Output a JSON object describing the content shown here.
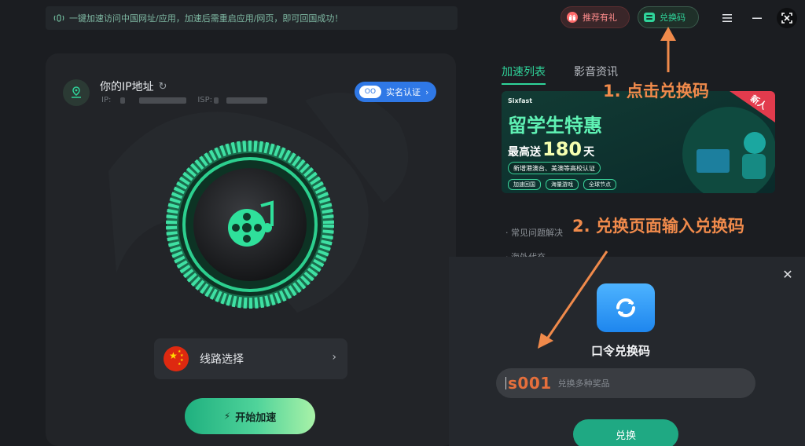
{
  "notice": {
    "text": "一键加速访问中国网址/应用，加速后需重启应用/网页，即可回国成功！"
  },
  "header": {
    "gift_label": "推荐有礼",
    "redeem_label": "兑换码"
  },
  "ip_card": {
    "title": "你的IP地址",
    "ip_prefix": "IP:",
    "isp_prefix": "ISP:",
    "verify_label": "实名认证",
    "verify_tag": "OO"
  },
  "route": {
    "label": "线路选择"
  },
  "start": {
    "label": "开始加速"
  },
  "tabs": [
    {
      "label": "加速列表"
    },
    {
      "label": "影音资讯"
    }
  ],
  "banner": {
    "brand": "Sixfast",
    "headline": "留学生特惠",
    "sub_prefix": "最高送",
    "sub_num": "180",
    "sub_suffix": "天",
    "strip": "新增港澳台、美澳等高校认证",
    "chips": [
      "加速回国",
      "海量游戏",
      "全球节点"
    ],
    "corner": "新人"
  },
  "faq": [
    "常见问题解决",
    "海外代充"
  ],
  "dialog": {
    "title": "口令兑换码",
    "typed_code": "s001",
    "placeholder": "兑换多种奖品",
    "button_label": "兑换"
  },
  "annotations": {
    "step1": "1. 点击兑换码",
    "step2": "2. 兑换页面输入兑换码"
  },
  "colors": {
    "accent": "#2fd49a",
    "annotation": "#f08a4b",
    "verify_blue": "#2f78e6",
    "dialog_button": "#1fa983"
  }
}
